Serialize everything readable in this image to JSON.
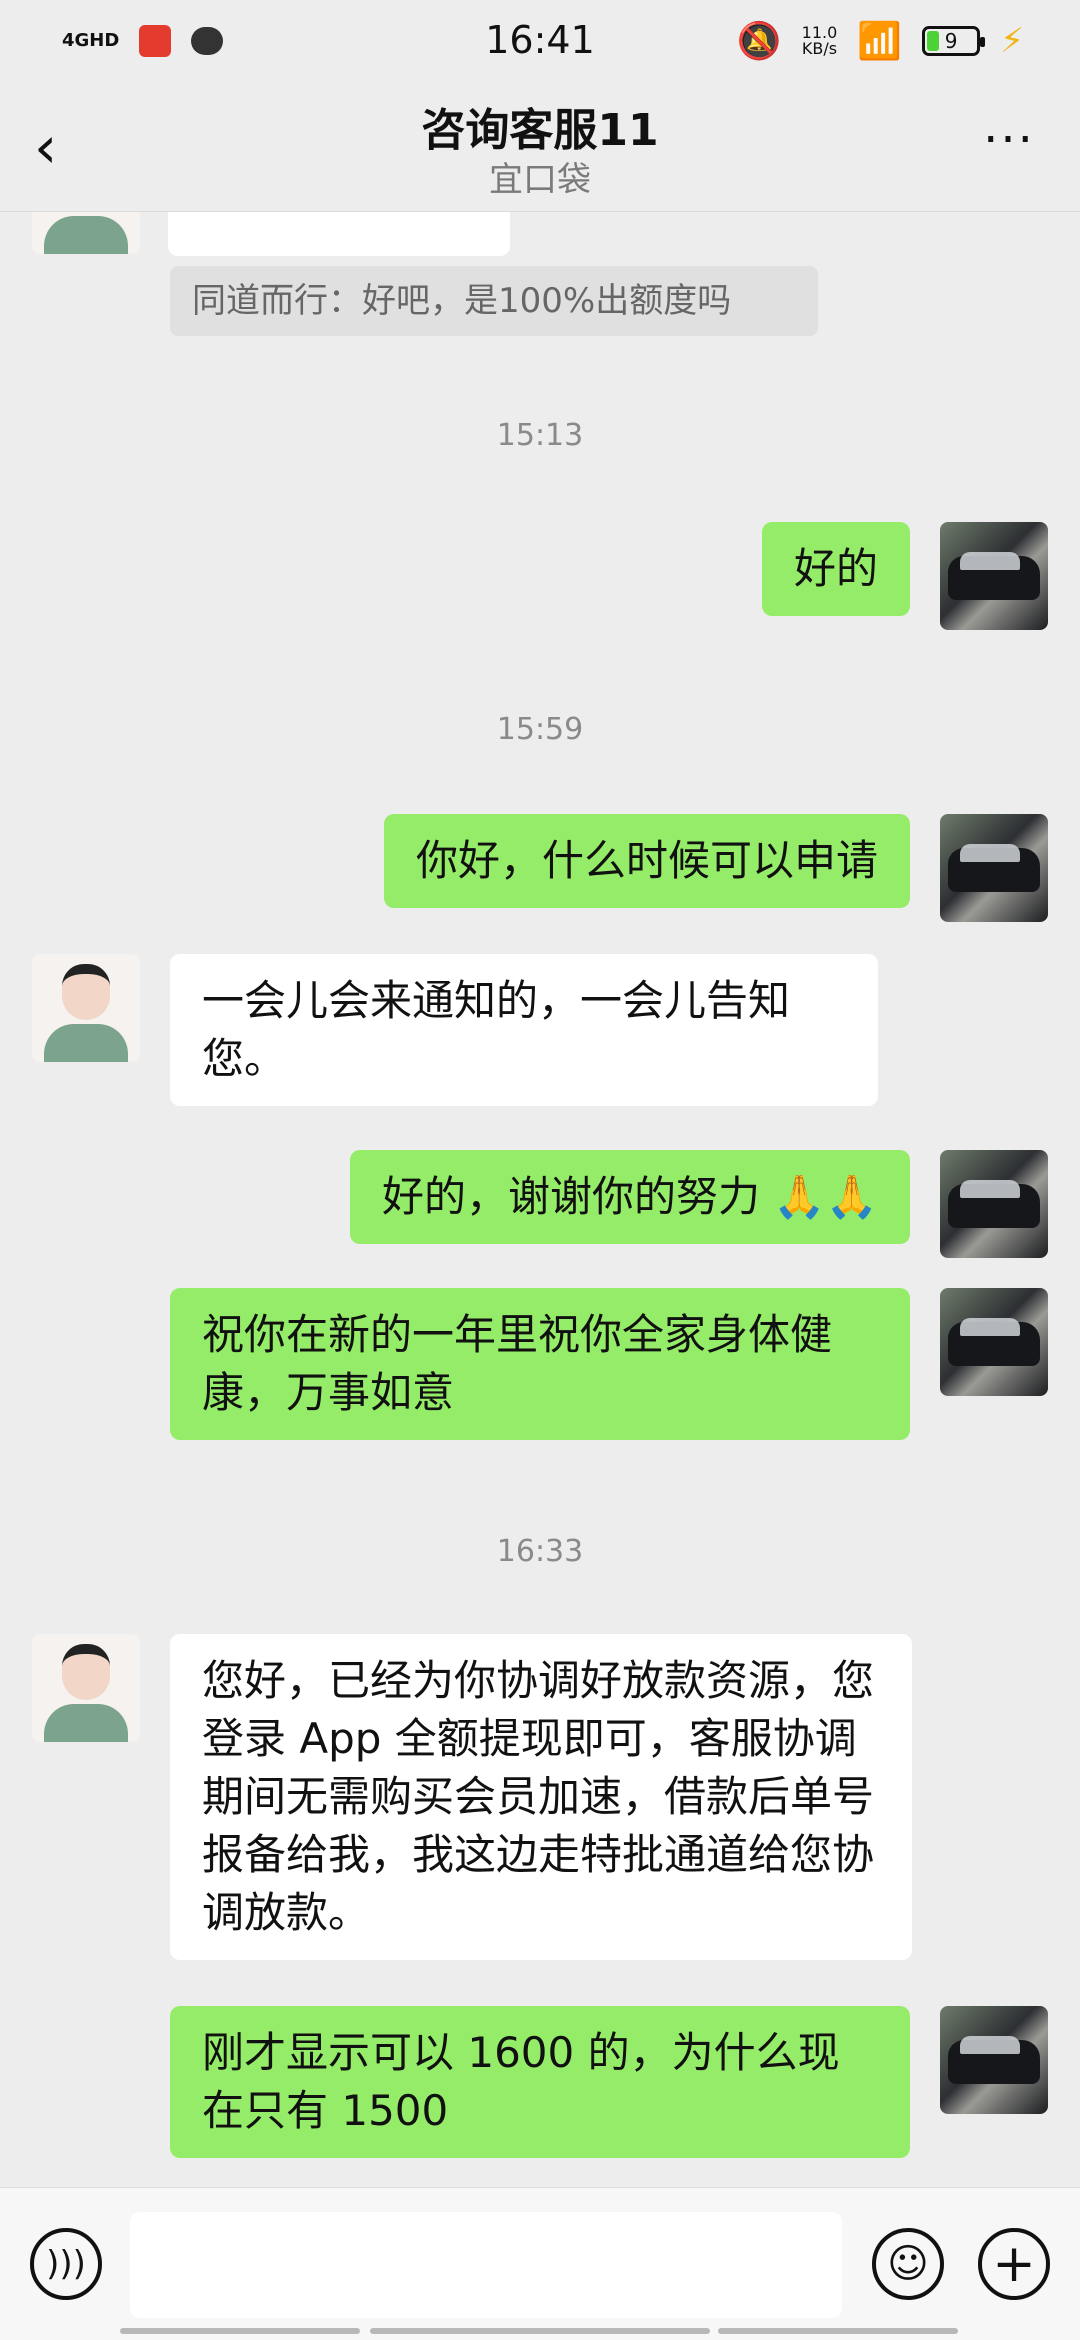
{
  "status_bar": {
    "network": "4GHD",
    "time": "16:41",
    "speed_value": "11.0",
    "speed_unit": "KB/s",
    "battery": "9"
  },
  "nav": {
    "title": "咨询客服11",
    "subtitle": "宜口袋"
  },
  "messages": [
    {
      "kind": "quote",
      "text": "同道而行：好吧，是100%出额度吗"
    },
    {
      "kind": "time",
      "text": "15:13"
    },
    {
      "kind": "out",
      "text": "好的"
    },
    {
      "kind": "time",
      "text": "15:59"
    },
    {
      "kind": "out",
      "text": "你好，什么时候可以申请"
    },
    {
      "kind": "in",
      "text": "一会儿会来通知的，一会儿告知您。"
    },
    {
      "kind": "out",
      "text": "好的，谢谢你的努力 🙏🙏"
    },
    {
      "kind": "out",
      "text": "祝你在新的一年里祝你全家身体健康，万事如意"
    },
    {
      "kind": "time",
      "text": "16:33"
    },
    {
      "kind": "in",
      "text": "您好，已经为你协调好放款资源，您登录 App 全额提现即可，客服协调期间无需购买会员加速，借款后单号报备给我，我这边走特批通道给您协调放款。"
    },
    {
      "kind": "out",
      "text": "刚才显示可以 1600 的，为什么现在只有 1500"
    }
  ],
  "icons": {
    "back": "chevron-left",
    "more": "ellipsis",
    "voice": "voice-wave",
    "emoji": "smiley",
    "plus": "plus-circle"
  },
  "colors": {
    "out_bubble": "#95ec69",
    "in_bubble": "#ffffff",
    "background": "#ededed"
  }
}
